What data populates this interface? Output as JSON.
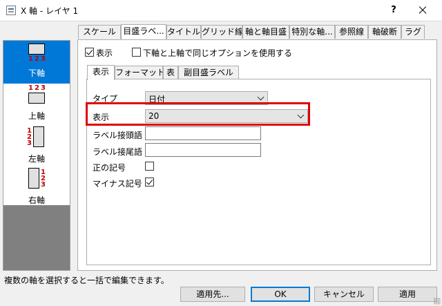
{
  "window": {
    "title": "X 軸 - レイヤ 1",
    "help_label": "?"
  },
  "axes_list": [
    {
      "label": "下軸",
      "selected": true
    },
    {
      "label": "上軸",
      "selected": false
    },
    {
      "label": "左軸",
      "selected": false
    },
    {
      "label": "右軸",
      "selected": false
    }
  ],
  "axis_numbers": [
    "1",
    "2",
    "3"
  ],
  "tabs": [
    "スケール",
    "目盛ラベ...",
    "タイトル",
    "グリッド線",
    "軸と軸目盛",
    "特別な軸...",
    "参照線",
    "軸破断",
    "ラグ"
  ],
  "active_tab_index": 1,
  "options": {
    "show_label": "表示",
    "show_checked": true,
    "same_options_label": "下軸と上軸で同じオプションを使用する",
    "same_options_checked": false
  },
  "subtabs": [
    "表示",
    "フォーマット",
    "表",
    "副目盛ラベル"
  ],
  "active_subtab_index": 0,
  "form": {
    "type_label": "タイプ",
    "type_value": "日付",
    "display_label": "表示",
    "display_value": "20",
    "prefix_label": "ラベル接頭語",
    "prefix_value": "",
    "suffix_label": "ラベル接尾語",
    "suffix_value": "",
    "plus_sign_label": "正の記号",
    "plus_sign_checked": false,
    "minus_sign_label": "マイナス記号",
    "minus_sign_checked": true
  },
  "status": "複数の軸を選択すると一括で編集できます。",
  "buttons": {
    "apply_to": "適用先...",
    "ok": "OK",
    "cancel": "キャンセル",
    "apply": "適用"
  },
  "colors": {
    "selection": "#0078d7",
    "highlight_border": "#e00000",
    "axis_number": "#c00000"
  }
}
